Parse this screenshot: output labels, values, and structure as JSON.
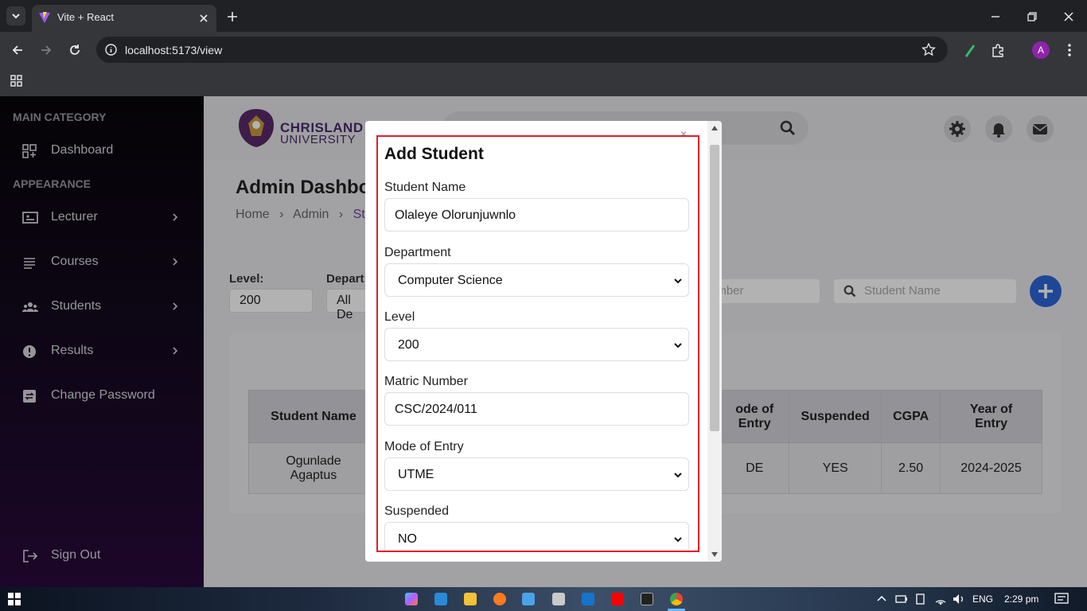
{
  "browser": {
    "tab_title": "Vite + React",
    "url": "localhost:5173/view",
    "profile_initial": "A"
  },
  "sidebar": {
    "main_category": "MAIN CATEGORY",
    "dashboard": "Dashboard",
    "appearance": "APPEARANCE",
    "items": [
      {
        "label": "Lecturer"
      },
      {
        "label": "Courses"
      },
      {
        "label": "Students"
      },
      {
        "label": "Results"
      },
      {
        "label": "Change Password"
      }
    ],
    "sign_out": "Sign Out"
  },
  "header": {
    "logo_line1": "CHRISLAND",
    "logo_line2": "UNIVERSITY"
  },
  "page": {
    "title": "Admin Dashboa",
    "breadcrumb": [
      "Home",
      "Admin",
      "St"
    ]
  },
  "filters": {
    "level_label": "Level:",
    "level_value": "200",
    "department_label": "Depart",
    "department_value": "All De",
    "matric_placeholder": "umber",
    "name_placeholder": "Student Name"
  },
  "table": {
    "headers": {
      "name": "Student Name",
      "mode_line1": "ode of",
      "mode_line2": "Entry",
      "suspended": "Suspended",
      "cgpa": "CGPA",
      "year_line1": "Year of",
      "year_line2": "Entry"
    },
    "row": {
      "name_line1": "Ogunlade",
      "name_line2": "Agaptus",
      "mode": "DE",
      "suspended": "YES",
      "cgpa": "2.50",
      "year": "2024-2025"
    }
  },
  "modal": {
    "close": "×",
    "title": "Add Student",
    "fields": {
      "name_label": "Student Name",
      "name_value": "Olaleye Olorunjuwnlo",
      "department_label": "Department",
      "department_value": "Computer Science",
      "level_label": "Level",
      "level_value": "200",
      "matric_label": "Matric Number",
      "matric_value": "CSC/2024/011",
      "mode_label": "Mode of Entry",
      "mode_value": "UTME",
      "suspended_label": "Suspended",
      "suspended_value": "NO"
    }
  },
  "taskbar": {
    "lang": "ENG",
    "time": "2:29 pm"
  },
  "colors": {
    "accent_blue": "#2b66d9",
    "highlight_red": "#e11d2a",
    "sidebar_dark": "#0f0818"
  }
}
